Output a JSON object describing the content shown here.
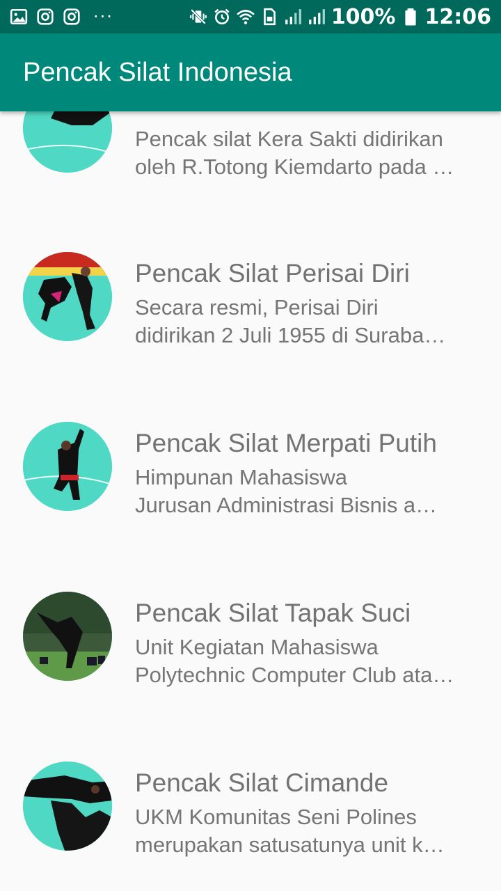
{
  "status_bar": {
    "battery": "100%",
    "time": "12:06",
    "more": "···",
    "icons_left": [
      "gallery-icon",
      "instagram-icon",
      "instagram-icon"
    ],
    "icons_right": [
      "vibrate-mute-icon",
      "alarm-icon",
      "wifi-icon",
      "sim-icon",
      "signal-icon",
      "signal-icon",
      "battery-icon"
    ]
  },
  "app_bar": {
    "title": "Pencak Silat Indonesia"
  },
  "list": {
    "items": [
      {
        "title": "",
        "desc_line1": "Pencak silat Kera Sakti didirikan",
        "desc_line2": "oleh R.Totong Kiemdarto pada …"
      },
      {
        "title": "Pencak Silat Perisai Diri",
        "desc_line1": "Secara resmi, Perisai Diri",
        "desc_line2": "didirikan 2 Juli 1955 di Suraba…"
      },
      {
        "title": "Pencak Silat Merpati Putih",
        "desc_line1": "Himpunan Mahasiswa",
        "desc_line2": "Jurusan Administrasi Bisnis a…"
      },
      {
        "title": "Pencak Silat Tapak Suci",
        "desc_line1": "Unit Kegiatan Mahasiswa",
        "desc_line2": "Polytechnic Computer Club ata…"
      },
      {
        "title": "Pencak Silat Cimande",
        "desc_line1": "UKM Komunitas Seni Polines",
        "desc_line2": "merupakan satusatunya unit k…"
      }
    ]
  },
  "colors": {
    "status_bar": "#00695c",
    "app_bar": "#00897b",
    "background": "#fafafa",
    "text": "#757575"
  }
}
